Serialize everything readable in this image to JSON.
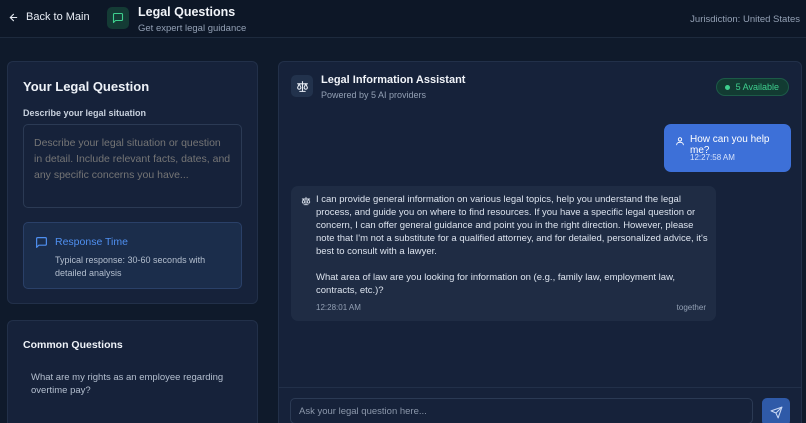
{
  "header": {
    "back_label": "Back to Main",
    "title": "Legal Questions",
    "subtitle": "Get expert legal guidance",
    "jurisdiction": "Jurisdiction: United States"
  },
  "question_panel": {
    "title": "Your Legal Question",
    "field_label": "Describe your legal situation",
    "placeholder": "Describe your legal situation or question in detail. Include relevant facts, dates, and any specific concerns you have...",
    "response_time": {
      "title": "Response Time",
      "body": "Typical response: 30-60 seconds with detailed analysis"
    }
  },
  "common_questions": {
    "title": "Common Questions",
    "items": [
      "What are my rights as an employee regarding overtime pay?"
    ]
  },
  "chat": {
    "assistant_name": "Legal Information Assistant",
    "assistant_sub": "Powered by 5 AI providers",
    "badge": "5 Available",
    "user_message": {
      "text": "How can you help me?",
      "time": "12:27:58 AM"
    },
    "bot_message": {
      "text": "I can provide general information on various legal topics, help you understand the legal process, and guide you on where to find resources. If you have a specific legal question or concern, I can offer general guidance and point you in the right direction. However, please note that I'm not a substitute for a qualified attorney, and for detailed, personalized advice, it's best to consult with a lawyer.\n\nWhat area of law are you looking for information on (e.g., family law, employment law, contracts, etc.)?",
      "time": "12:28:01 AM",
      "provider": "together"
    },
    "input_placeholder": "Ask your legal question here..."
  },
  "colors": {
    "background": "#0f1a2b",
    "panel": "#16223a",
    "accent": "#3d70d8",
    "available": "#3ecf8e"
  },
  "icons": {
    "back": "arrow-left-icon",
    "app": "message-square-icon",
    "response_time": "message-square-icon",
    "assistant": "scale-icon",
    "user": "user-icon",
    "send": "send-icon"
  }
}
